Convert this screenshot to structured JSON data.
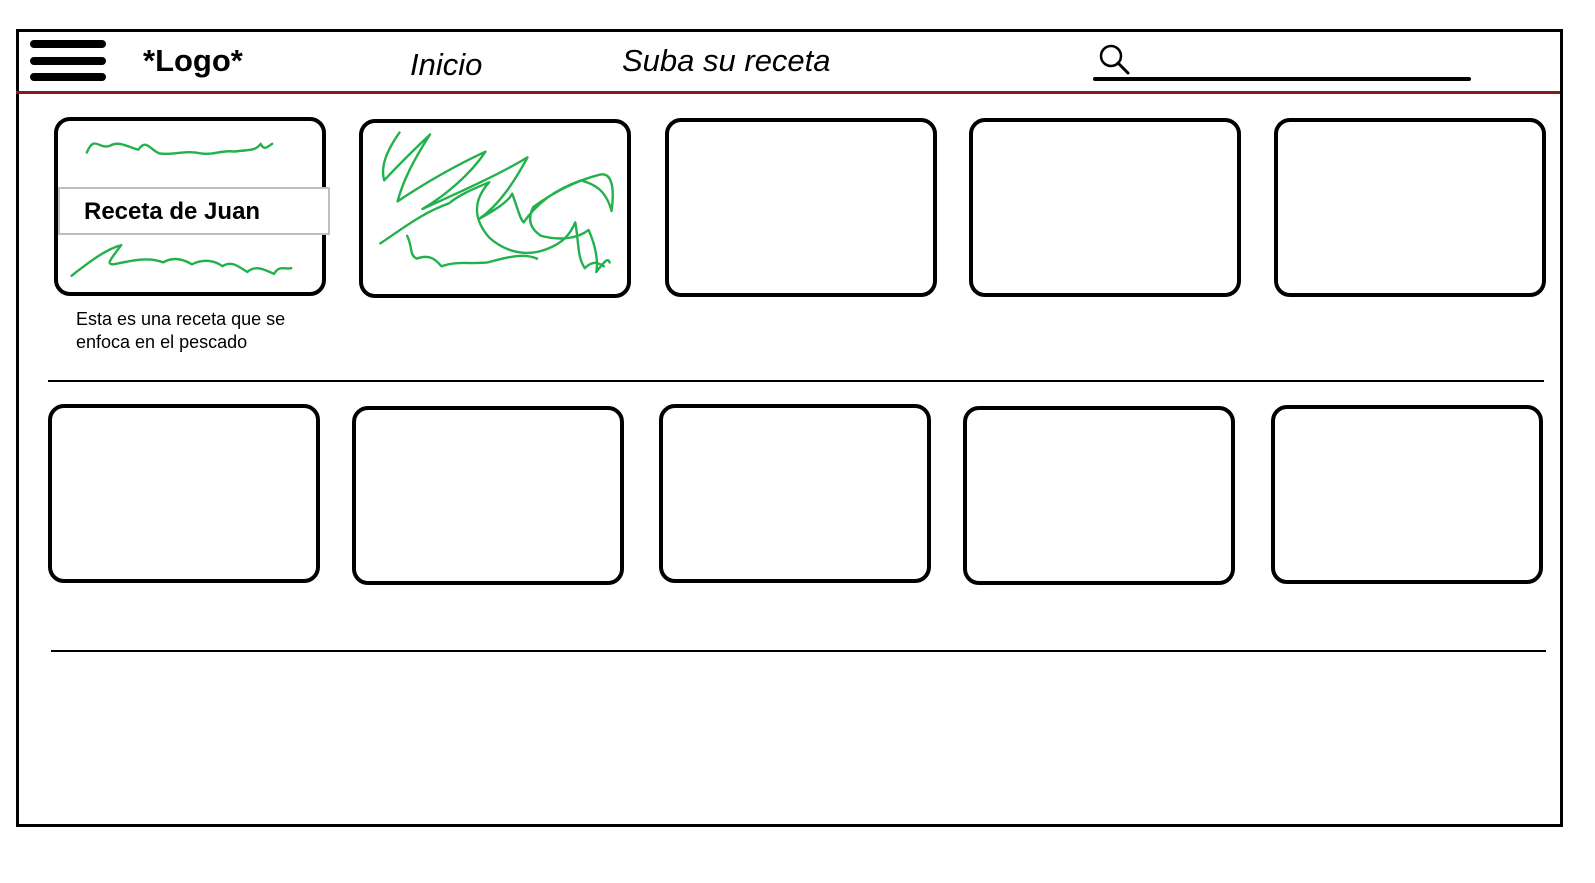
{
  "header": {
    "logo": "*Logo*",
    "nav": {
      "home_label": "Inicio",
      "upload_label": "Suba su receta"
    },
    "menu_icon": "hamburger-icon",
    "search_icon": "search-icon",
    "accent_color": "#8b1a1a"
  },
  "recipes": {
    "featured": {
      "title": "Receta de Juan",
      "description": "Esta es una receta que se enfoca en el pescado",
      "scribble_color": "#22b14c"
    }
  }
}
